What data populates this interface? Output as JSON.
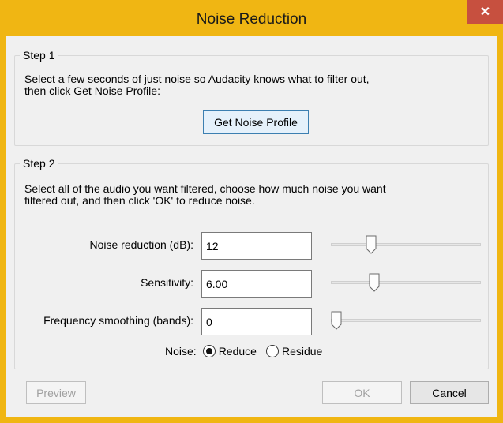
{
  "window": {
    "title": "Noise Reduction",
    "close_glyph": "✕",
    "accent_color": "#f0b613",
    "close_color": "#c7503f"
  },
  "step1": {
    "legend": "Step 1",
    "description_line1": "Select a few seconds of just noise so Audacity knows what to filter out,",
    "description_line2": "then click Get Noise Profile:",
    "get_profile_label": "Get Noise Profile"
  },
  "step2": {
    "legend": "Step 2",
    "description_line1": "Select all of the audio you want filtered, choose how much noise you want",
    "description_line2": "filtered out, and then click 'OK' to reduce noise.",
    "rows": [
      {
        "label": "Noise reduction (dB):",
        "value": "12",
        "slider_fraction": 0.25
      },
      {
        "label": "Sensitivity:",
        "value": "6.00",
        "slider_fraction": 0.27
      },
      {
        "label": "Frequency smoothing (bands):",
        "value": "0",
        "slider_fraction": 0.0
      }
    ],
    "noise": {
      "label": "Noise:",
      "options": [
        "Reduce",
        "Residue"
      ],
      "selected": "Reduce"
    }
  },
  "footer": {
    "preview_label": "Preview",
    "ok_label": "OK",
    "cancel_label": "Cancel"
  }
}
